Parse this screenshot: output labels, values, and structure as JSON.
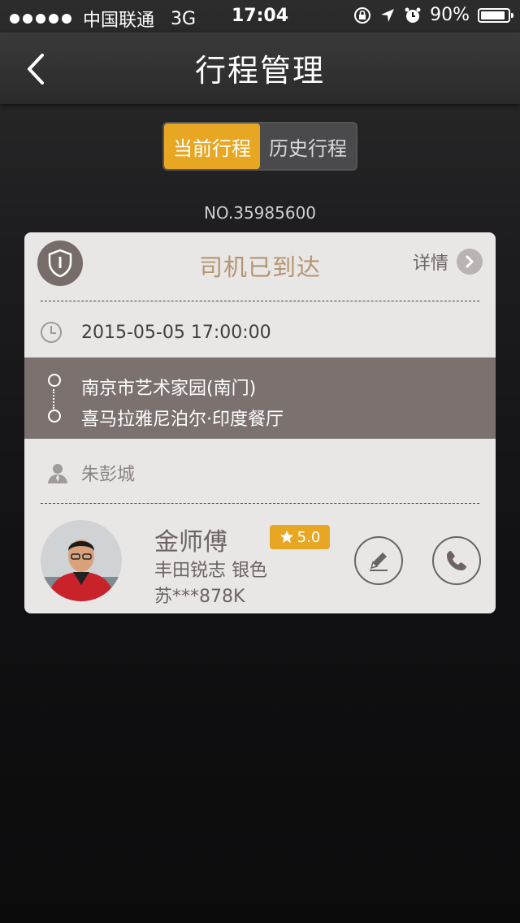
{
  "status_bar": {
    "carrier": "中国联通",
    "network": "3G",
    "time": "17:04",
    "battery": "90%",
    "battery_level": 0.9
  },
  "nav": {
    "title": "行程管理",
    "back_icon": "chevron-left-icon"
  },
  "tabs": [
    {
      "label": "当前行程",
      "active": true
    },
    {
      "label": "历史行程",
      "active": false
    }
  ],
  "order_number": "NO.35985600",
  "trip": {
    "status": "司机已到达",
    "detail_label": "详情",
    "datetime": "2015-05-05 17:00:00",
    "from": "南京市艺术家园(南门)",
    "to": "喜马拉雅尼泊尔·印度餐厅",
    "passenger": "朱彭城"
  },
  "driver": {
    "name": "金师傅",
    "rating": "5.0",
    "car": "丰田锐志  银色",
    "plate": "苏***878K"
  },
  "colors": {
    "accent": "#e7a722",
    "status_text": "#b39670",
    "route_bg": "#7b7270",
    "card_bg": "#e9e6e6"
  }
}
